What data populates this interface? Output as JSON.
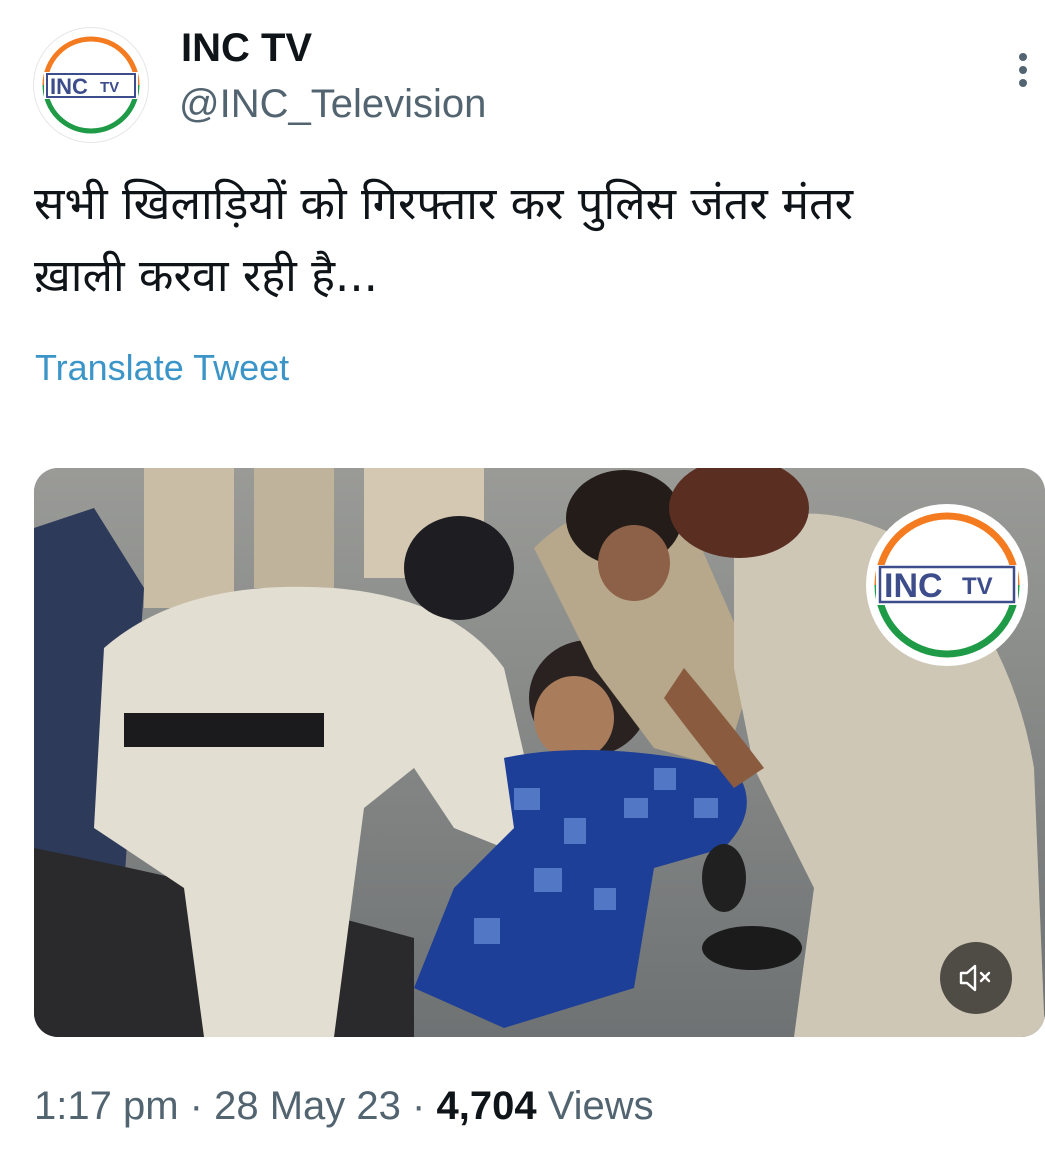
{
  "author": {
    "display_name": "INC TV",
    "handle": "@INC_Television",
    "avatar_logo_text": "INCTV"
  },
  "tweet": {
    "text_line1": "सभी खिलाड़ियों को गिरफ्तार कर पुलिस जंतर मंतर",
    "text_line2": "ख़ाली करवा रही है...",
    "translate_label": "Translate Tweet"
  },
  "media": {
    "type": "video",
    "watermark_text": "INCTV",
    "mute_icon": "speaker-muted-icon"
  },
  "meta": {
    "time": "1:17 pm",
    "separator": "·",
    "date": "28 May 23",
    "views_count": "4,704",
    "views_label": "Views"
  },
  "icons": {
    "more": "more-vertical-icon"
  },
  "colors": {
    "link": "#3b95c8",
    "secondary_text": "#536471",
    "logo_orange": "#f47b20",
    "logo_green": "#1f9a46",
    "logo_blue": "#3d4d8c"
  }
}
